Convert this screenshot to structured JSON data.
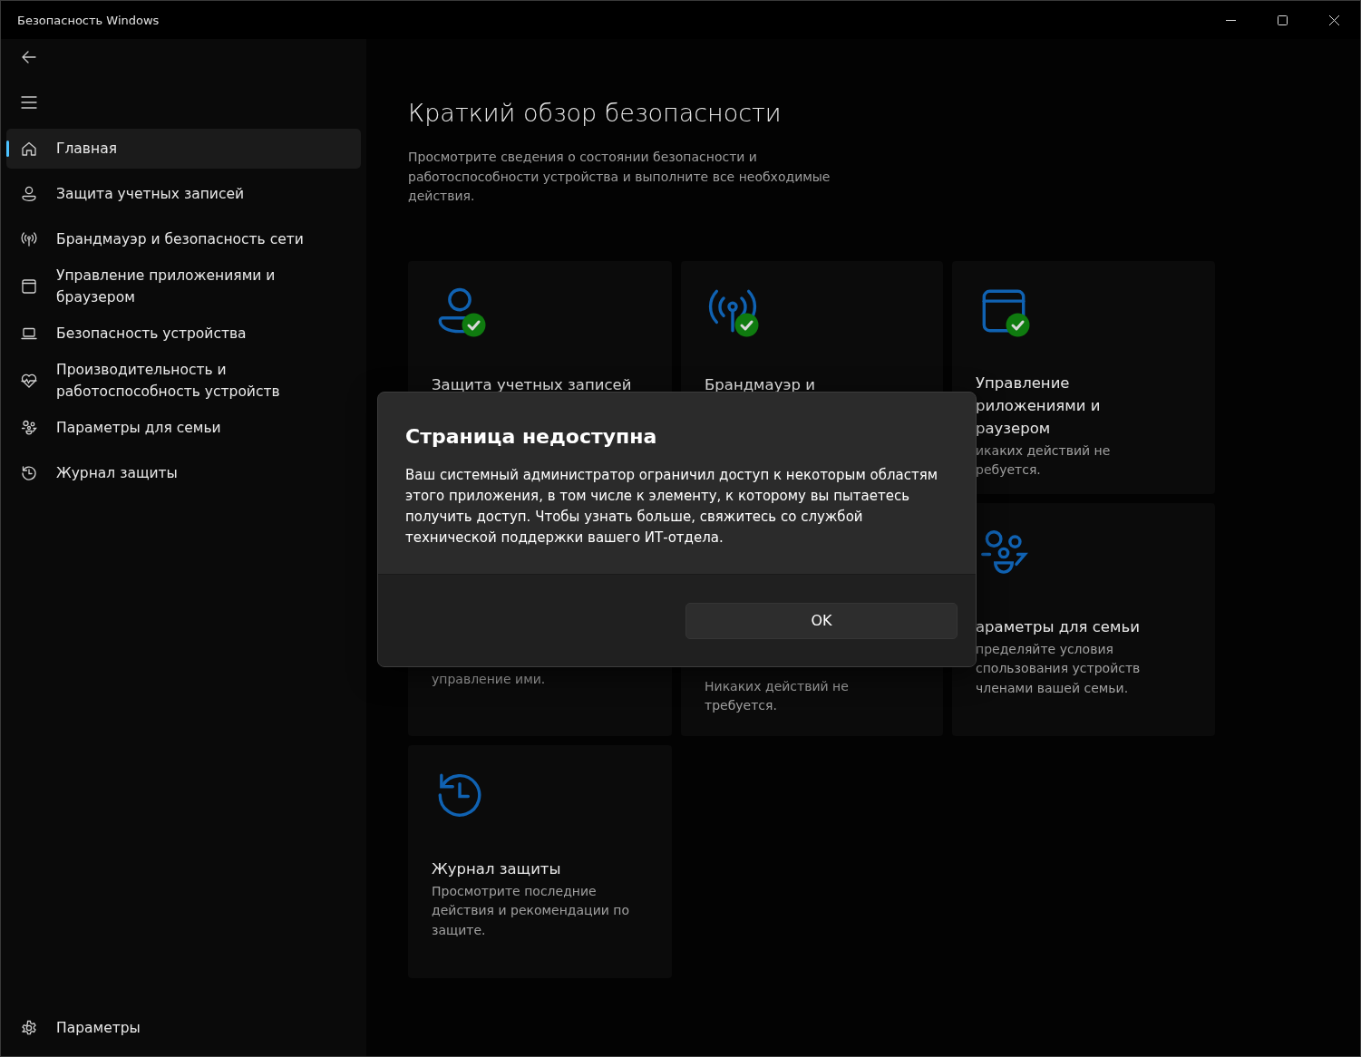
{
  "window": {
    "title": "Безопасность Windows"
  },
  "nav": {
    "items": [
      {
        "label": "Главная",
        "kind": "home",
        "selected": true
      },
      {
        "label": "Защита учетных записей",
        "kind": "person",
        "selected": false
      },
      {
        "label": "Брандмауэр и безопасность сети",
        "kind": "antenna",
        "selected": false
      },
      {
        "label": "Управление приложениями и браузером",
        "kind": "window",
        "selected": false
      },
      {
        "label": "Безопасность устройства",
        "kind": "laptop",
        "selected": false
      },
      {
        "label": "Производительность и работоспособность устройств",
        "kind": "heart",
        "selected": false
      },
      {
        "label": "Параметры для семьи",
        "kind": "family",
        "selected": false
      },
      {
        "label": "Журнал защиты",
        "kind": "history",
        "selected": false
      }
    ],
    "settings": {
      "label": "Параметры"
    }
  },
  "page": {
    "title": "Краткий обзор безопасности",
    "subtitle": "Просмотрите сведения о состоянии безопасности и работоспособности устройства и выполните все необходимые действия."
  },
  "cards": [
    {
      "kind": "person",
      "status_ok": true,
      "title": [
        "Защита учетных записей"
      ]
    },
    {
      "kind": "antenna",
      "status_ok": true,
      "title": [
        "Брандмауэр и"
      ]
    },
    {
      "kind": "window",
      "status_ok": true,
      "title": [
        "Управление",
        "риложениями и",
        "раузером"
      ],
      "description": [
        "икаких действий не",
        "ребуется."
      ]
    },
    {
      "description": [
        "управление ими."
      ]
    },
    {
      "description": [
        "Никаких действий не",
        "требуется."
      ]
    },
    {
      "kind": "family",
      "status_ok": false,
      "title": [
        "араметры для семьи"
      ],
      "description": [
        "пределяйте условия",
        "спользования устройств",
        "членами вашей семьи."
      ]
    },
    {
      "kind": "history",
      "status_ok": false,
      "title": [
        "Журнал защиты"
      ],
      "description": [
        "Просмотрите последние действия и рекомендации по защите."
      ]
    }
  ],
  "dialog": {
    "title": "Страница недоступна",
    "message": "Ваш системный администратор ограничил доступ к некоторым областям этого приложения, в том числе к элементу, к которому вы пытаетесь получить доступ. Чтобы узнать больше, свяжитесь со службой технической поддержки вашего ИТ-отдела.",
    "button": "OK"
  }
}
